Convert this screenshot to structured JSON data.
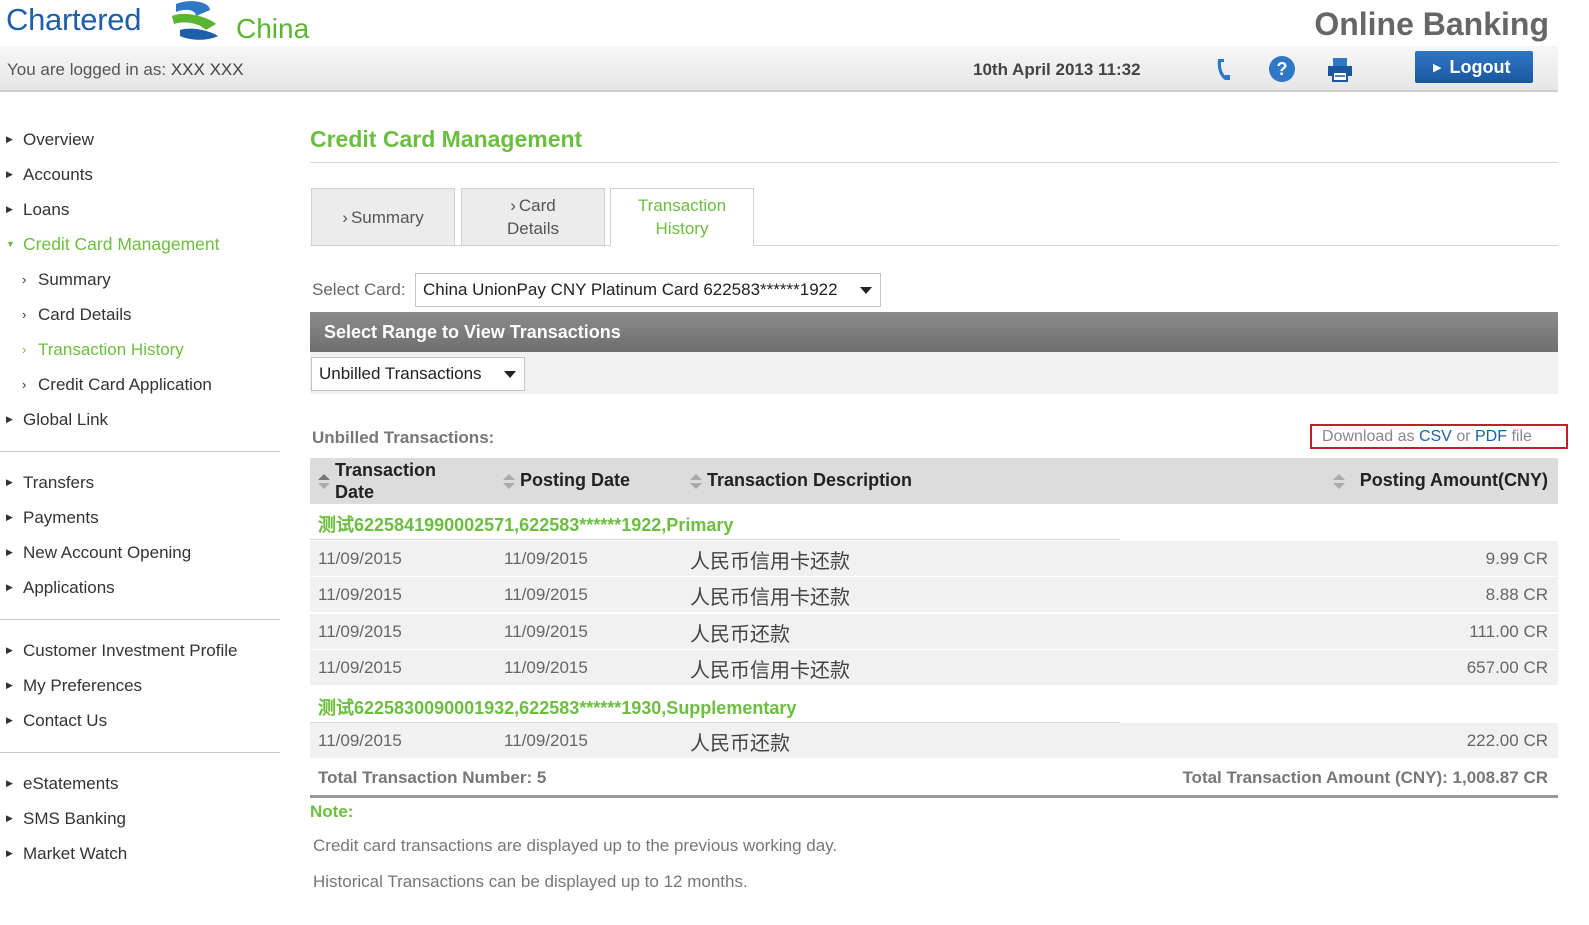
{
  "header": {
    "brand_name": "Chartered",
    "brand_country": "China",
    "app_title": "Online Banking",
    "login_prefix": "You are logged in as:",
    "user_name": "XXX XXX",
    "datetime": "10th April 2013 11:32",
    "logout_label": "Logout"
  },
  "sidebar": {
    "group1": [
      {
        "label": "Overview"
      },
      {
        "label": "Accounts"
      },
      {
        "label": "Loans"
      },
      {
        "label": "Credit Card Management"
      }
    ],
    "sub": [
      {
        "label": "Summary"
      },
      {
        "label": "Card Details"
      },
      {
        "label": "Transaction History"
      },
      {
        "label": "Credit Card Application"
      }
    ],
    "global_link": "Global Link",
    "group2": [
      {
        "label": "Transfers"
      },
      {
        "label": "Payments"
      },
      {
        "label": "New Account Opening"
      },
      {
        "label": "Applications"
      }
    ],
    "group3": [
      {
        "label": "Customer Investment Profile"
      },
      {
        "label": "My Preferences"
      },
      {
        "label": "Contact Us"
      }
    ],
    "group4": [
      {
        "label": "eStatements"
      },
      {
        "label": "SMS Banking"
      },
      {
        "label": "Market Watch"
      }
    ]
  },
  "main": {
    "page_title": "Credit Card Management",
    "tabs": [
      {
        "label": "Summary"
      },
      {
        "label_line1": "Card",
        "label_line2": "Details"
      },
      {
        "label_line1": "Transaction",
        "label_line2": "History"
      }
    ],
    "select_card_label": "Select Card:",
    "selected_card": "China UnionPay CNY Platinum Card 622583******1922",
    "range_header": "Select Range to View Transactions",
    "range_value": "Unbilled Transactions",
    "unbilled_label": "Unbilled Transactions:",
    "download": {
      "prefix": "Download as",
      "csv": "CSV",
      "or": "or",
      "pdf": "PDF",
      "suffix": "file"
    }
  },
  "table": {
    "headers": {
      "transaction_date_1": "Transaction",
      "transaction_date_2": "Date",
      "posting_date": "Posting Date",
      "description": "Transaction Description",
      "amount": "Posting Amount(CNY)"
    },
    "groups": [
      {
        "title": "测试6225841990002571,622583******1922,Primary",
        "rows": [
          {
            "tdate": "11/09/2015",
            "pdate": "11/09/2015",
            "desc": "人民币信用卡还款",
            "amount": "9.99 CR"
          },
          {
            "tdate": "11/09/2015",
            "pdate": "11/09/2015",
            "desc": "人民币信用卡还款",
            "amount": "8.88 CR"
          },
          {
            "tdate": "11/09/2015",
            "pdate": "11/09/2015",
            "desc": "人民币还款",
            "amount": "111.00 CR"
          },
          {
            "tdate": "11/09/2015",
            "pdate": "11/09/2015",
            "desc": "人民币信用卡还款",
            "amount": "657.00 CR"
          }
        ]
      },
      {
        "title": "测试6225830090001932,622583******1930,Supplementary",
        "rows": [
          {
            "tdate": "11/09/2015",
            "pdate": "11/09/2015",
            "desc": "人民币还款",
            "amount": "222.00 CR"
          }
        ]
      }
    ],
    "total_number": "Total Transaction Number: 5",
    "total_amount": "Total Transaction Amount (CNY): 1,008.87 CR"
  },
  "notes": {
    "title": "Note:",
    "lines": [
      "Credit card transactions are displayed up to the previous working day.",
      "Historical Transactions can be displayed up to 12 months."
    ]
  },
  "colors": {
    "brand_blue": "#1f5fa8",
    "brand_green": "#6cbe3f",
    "alert_red": "#c21f2b"
  }
}
